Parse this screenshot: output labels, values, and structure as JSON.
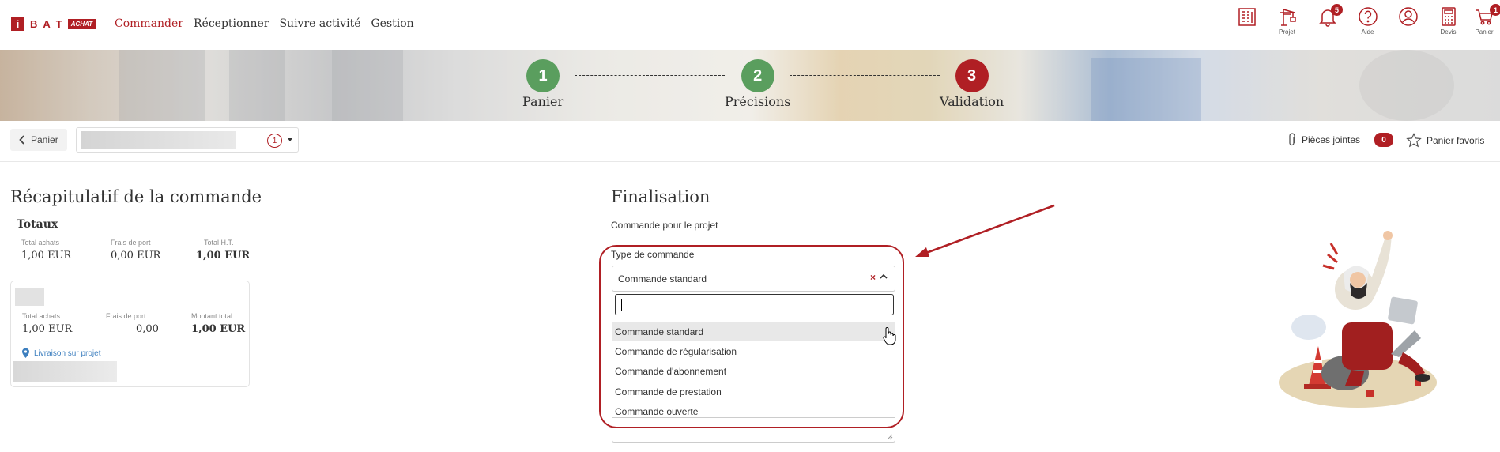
{
  "header": {
    "logo_letters": [
      "B",
      "A",
      "T"
    ],
    "logo_i": "i",
    "logo_tag": "ACHAT",
    "nav": [
      {
        "label": "Commander",
        "active": true
      },
      {
        "label": "Réceptionner",
        "active": false
      },
      {
        "label": "Suivre activité",
        "active": false
      },
      {
        "label": "Gestion",
        "active": false
      }
    ],
    "icons": [
      {
        "name": "building-icon",
        "label": ""
      },
      {
        "name": "crane-icon",
        "label": "Projet"
      },
      {
        "name": "bell-icon",
        "label": "",
        "badge": "5"
      },
      {
        "name": "help-icon",
        "label": "Aide"
      },
      {
        "name": "user-icon",
        "label": ""
      },
      {
        "name": "calculator-icon",
        "label": "Devis"
      },
      {
        "name": "cart-icon",
        "label": "Panier",
        "badge": "1"
      }
    ]
  },
  "steps": [
    {
      "number": "1",
      "label": "Panier",
      "state": "done",
      "color": "#5a9e5e"
    },
    {
      "number": "2",
      "label": "Précisions",
      "state": "done",
      "color": "#5a9e5e"
    },
    {
      "number": "3",
      "label": "Validation",
      "state": "current",
      "color": "#b01f24"
    }
  ],
  "subbar": {
    "back_label": "Panier",
    "project_count": "1",
    "attachments_label": "Pièces jointes",
    "attachments_count": "0",
    "favorites_label": "Panier favoris"
  },
  "recap": {
    "title": "Récapitulatif de la commande",
    "totals_title": "Totaux",
    "totals": [
      {
        "label": "Total achats",
        "value": "1,00 EUR",
        "bold": false
      },
      {
        "label": "Frais de port",
        "value": "0,00 EUR",
        "bold": false
      },
      {
        "label": "Total H.T.",
        "value": "1,00 EUR",
        "bold": true
      }
    ],
    "card": {
      "cols": [
        {
          "label": "Total achats",
          "value": "1,00 EUR",
          "bold": false
        },
        {
          "label": "Frais de port",
          "value": "0,00",
          "bold": false
        },
        {
          "label": "Montant total",
          "value": "1,00 EUR",
          "bold": true
        }
      ],
      "delivery_label": "Livraison sur projet"
    }
  },
  "finalisation": {
    "title": "Finalisation",
    "project_label": "Commande pour le projet",
    "order_type_label": "Type de commande",
    "selected_value": "Commande standard",
    "search_value": "",
    "options": [
      "Commande standard",
      "Commande de régularisation",
      "Commande d'abonnement",
      "Commande de prestation",
      "Commande ouverte"
    ],
    "highlighted_index": 0
  },
  "colors": {
    "brand_red": "#b01f24",
    "step_green": "#5a9e5e",
    "link_blue": "#3d7fbf"
  }
}
